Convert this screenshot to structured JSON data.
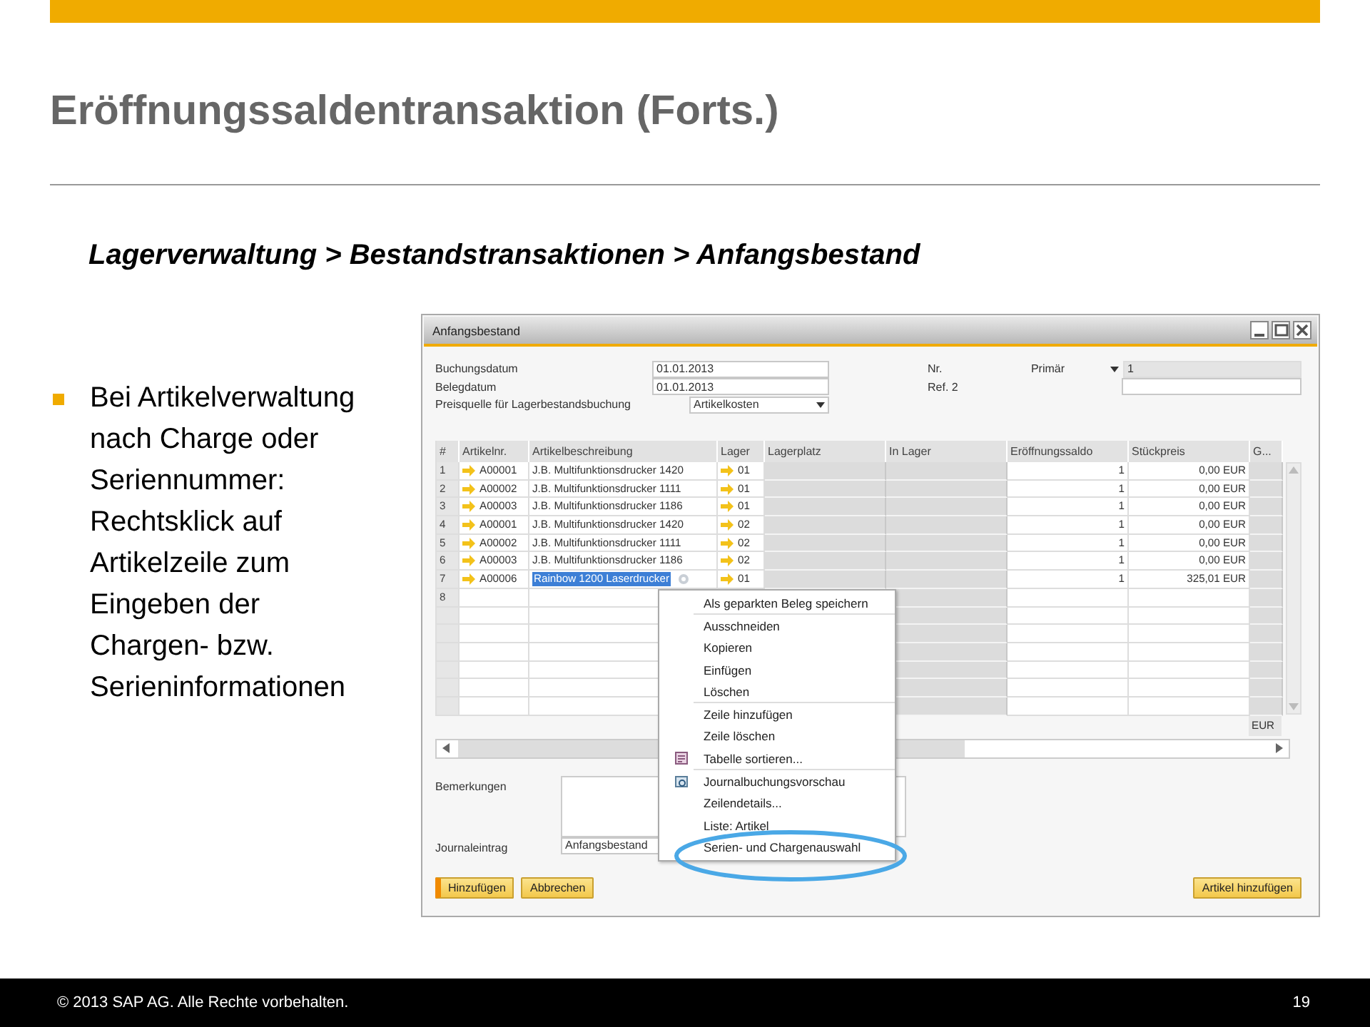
{
  "slide": {
    "title": "Eröffnungssaldentransaktion (Forts.)",
    "breadcrumb": "Lagerverwaltung > Bestandstransaktionen > Anfangsbestand",
    "bullets": [
      "Bei Artikelverwaltung nach Charge oder Seriennummer: Rechtsklick auf Artikelzeile zum Eingeben der Chargen- bzw. Serieninformationen"
    ],
    "footer": {
      "copyright": "© 2013 SAP AG. Alle Rechte vorbehalten.",
      "page": "19"
    }
  },
  "window": {
    "title": "Anfangsbestand",
    "fields_left": [
      {
        "label": "Buchungsdatum",
        "value": "01.01.2013",
        "kind": "text"
      },
      {
        "label": "Belegdatum",
        "value": "01.01.2013",
        "kind": "text"
      },
      {
        "label": "Preisquelle für Lagerbestandsbuchung",
        "value": "Artikelkosten",
        "kind": "dropdown"
      }
    ],
    "fields_right": [
      {
        "label": "Nr.",
        "series": "Primär",
        "value": "1",
        "disabled": true
      },
      {
        "label": "Ref. 2",
        "disabled": false
      }
    ],
    "table": {
      "columns": [
        {
          "label": "#",
          "kind": "index"
        },
        {
          "label": "Artikelnr.",
          "kind": "link"
        },
        {
          "label": "Artikelbeschreibung",
          "kind": "text"
        },
        {
          "label": "Lager",
          "kind": "link"
        },
        {
          "label": "Lagerplatz",
          "kind": "readonly"
        },
        {
          "label": "In Lager",
          "kind": "readonly"
        },
        {
          "label": "Eröffnungssaldo",
          "kind": "number"
        },
        {
          "label": "Stückpreis",
          "kind": "number"
        },
        {
          "label": "G...",
          "kind": "readonly"
        }
      ],
      "rows": [
        {
          "cells": [
            "1",
            "A00001",
            "J.B. Multifunktionsdrucker 1420",
            "01",
            null,
            null,
            "1",
            "0,00 EUR",
            null
          ],
          "selected": false
        },
        {
          "cells": [
            "2",
            "A00002",
            "J.B. Multifunktionsdrucker 1111",
            "01",
            null,
            null,
            "1",
            "0,00 EUR",
            null
          ],
          "selected": false
        },
        {
          "cells": [
            "3",
            "A00003",
            "J.B. Multifunktionsdrucker 1186",
            "01",
            null,
            null,
            "1",
            "0,00 EUR",
            null
          ],
          "selected": false
        },
        {
          "cells": [
            "4",
            "A00001",
            "J.B. Multifunktionsdrucker 1420",
            "02",
            null,
            null,
            "1",
            "0,00 EUR",
            null
          ],
          "selected": false
        },
        {
          "cells": [
            "5",
            "A00002",
            "J.B. Multifunktionsdrucker 1111",
            "02",
            null,
            null,
            "1",
            "0,00 EUR",
            null
          ],
          "selected": false
        },
        {
          "cells": [
            "6",
            "A00003",
            "J.B. Multifunktionsdrucker 1186",
            "02",
            null,
            null,
            "1",
            "0,00 EUR",
            null
          ],
          "selected": false
        },
        {
          "cells": [
            "7",
            "A00006",
            "Rainbow 1200 Laserdrucker",
            "01",
            null,
            null,
            "1",
            "325,01 EUR",
            null
          ],
          "selected": true
        },
        {
          "cells": [
            "8",
            null,
            null,
            null,
            null,
            null,
            null,
            null,
            null
          ],
          "selected": false
        }
      ],
      "currency_total": "EUR"
    },
    "remarks_label": "Bemerkungen",
    "journal_label": "Journaleintrag",
    "journal_value": "Anfangsbestand",
    "buttons": [
      {
        "label": "Hinzufügen",
        "default": true
      },
      {
        "label": "Abbrechen",
        "default": false
      }
    ],
    "right_button": "Artikel hinzufügen",
    "context_menu": {
      "groups": [
        [
          {
            "label": "Als geparkten Beleg speichern",
            "kind": "text"
          }
        ],
        [
          {
            "label": "Ausschneiden",
            "kind": "text"
          },
          {
            "label": "Kopieren",
            "kind": "text"
          },
          {
            "label": "Einfügen",
            "kind": "text"
          },
          {
            "label": "Löschen",
            "kind": "text"
          }
        ],
        [
          {
            "label": "Zeile hinzufügen",
            "kind": "text"
          },
          {
            "label": "Zeile löschen",
            "kind": "text"
          },
          {
            "label": "Tabelle sortieren...",
            "kind": "sort"
          }
        ],
        [
          {
            "label": "Journalbuchungsvorschau",
            "kind": "preview"
          },
          {
            "label": "Zeilendetails...",
            "kind": "text"
          },
          {
            "label": "Liste: Artikel",
            "kind": "text"
          },
          {
            "label": "Serien- und Chargenauswahl",
            "kind": "text"
          }
        ]
      ]
    }
  }
}
